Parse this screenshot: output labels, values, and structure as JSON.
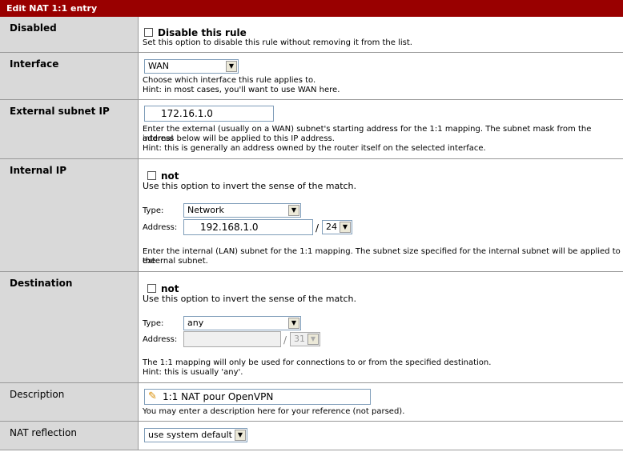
{
  "header": {
    "title": "Edit NAT 1:1 entry"
  },
  "disabled": {
    "label": "Disabled",
    "checkbox_label": "Disable this rule",
    "help": "Set this option to disable this rule without removing it from the list."
  },
  "interface": {
    "label": "Interface",
    "selected": "WAN",
    "help1": "Choose which interface this rule applies to.",
    "help2": "Hint: in most cases, you'll want to use WAN here."
  },
  "external": {
    "label": "External subnet IP",
    "value": "172.16.1.0",
    "help1": "Enter the external (usually on a WAN) subnet's starting address for the 1:1 mapping. The subnet mask from the internal",
    "help2": "address below will be applied to this IP address.",
    "help3": "Hint: this is generally an address owned by the router itself on the selected interface."
  },
  "internal": {
    "label": "Internal IP",
    "not_label": "not",
    "invert_help": "Use this option to invert the sense of the match.",
    "type_label": "Type:",
    "type_value": "Network",
    "address_label": "Address:",
    "address_value": "192.168.1.0",
    "slash": "/",
    "mask_value": "24",
    "help1": "Enter the internal (LAN) subnet for the 1:1 mapping. The subnet size specified for the internal subnet will be applied to the",
    "help2": "external subnet."
  },
  "destination": {
    "label": "Destination",
    "not_label": "not",
    "invert_help": "Use this option to invert the sense of the match.",
    "type_label": "Type:",
    "type_value": "any",
    "address_label": "Address:",
    "address_value": "",
    "slash": "/",
    "mask_value": "31",
    "help1": "The 1:1 mapping will only be used for connections to or from the specified destination.",
    "help2": "Hint: this is usually 'any'."
  },
  "description": {
    "label": "Description",
    "value": "1:1 NAT pour OpenVPN",
    "help": "You may enter a description here for your reference (not parsed)."
  },
  "nat_reflection": {
    "label": "NAT reflection",
    "selected": "use system default"
  },
  "icons": {
    "checkbox": "checkbox-icon",
    "dropdown": "dropdown-arrow-icon",
    "pencil": "pencil-icon"
  },
  "colors": {
    "title_bg": "#990000",
    "label_bg": "#d9d9d9",
    "border": "#999999"
  }
}
